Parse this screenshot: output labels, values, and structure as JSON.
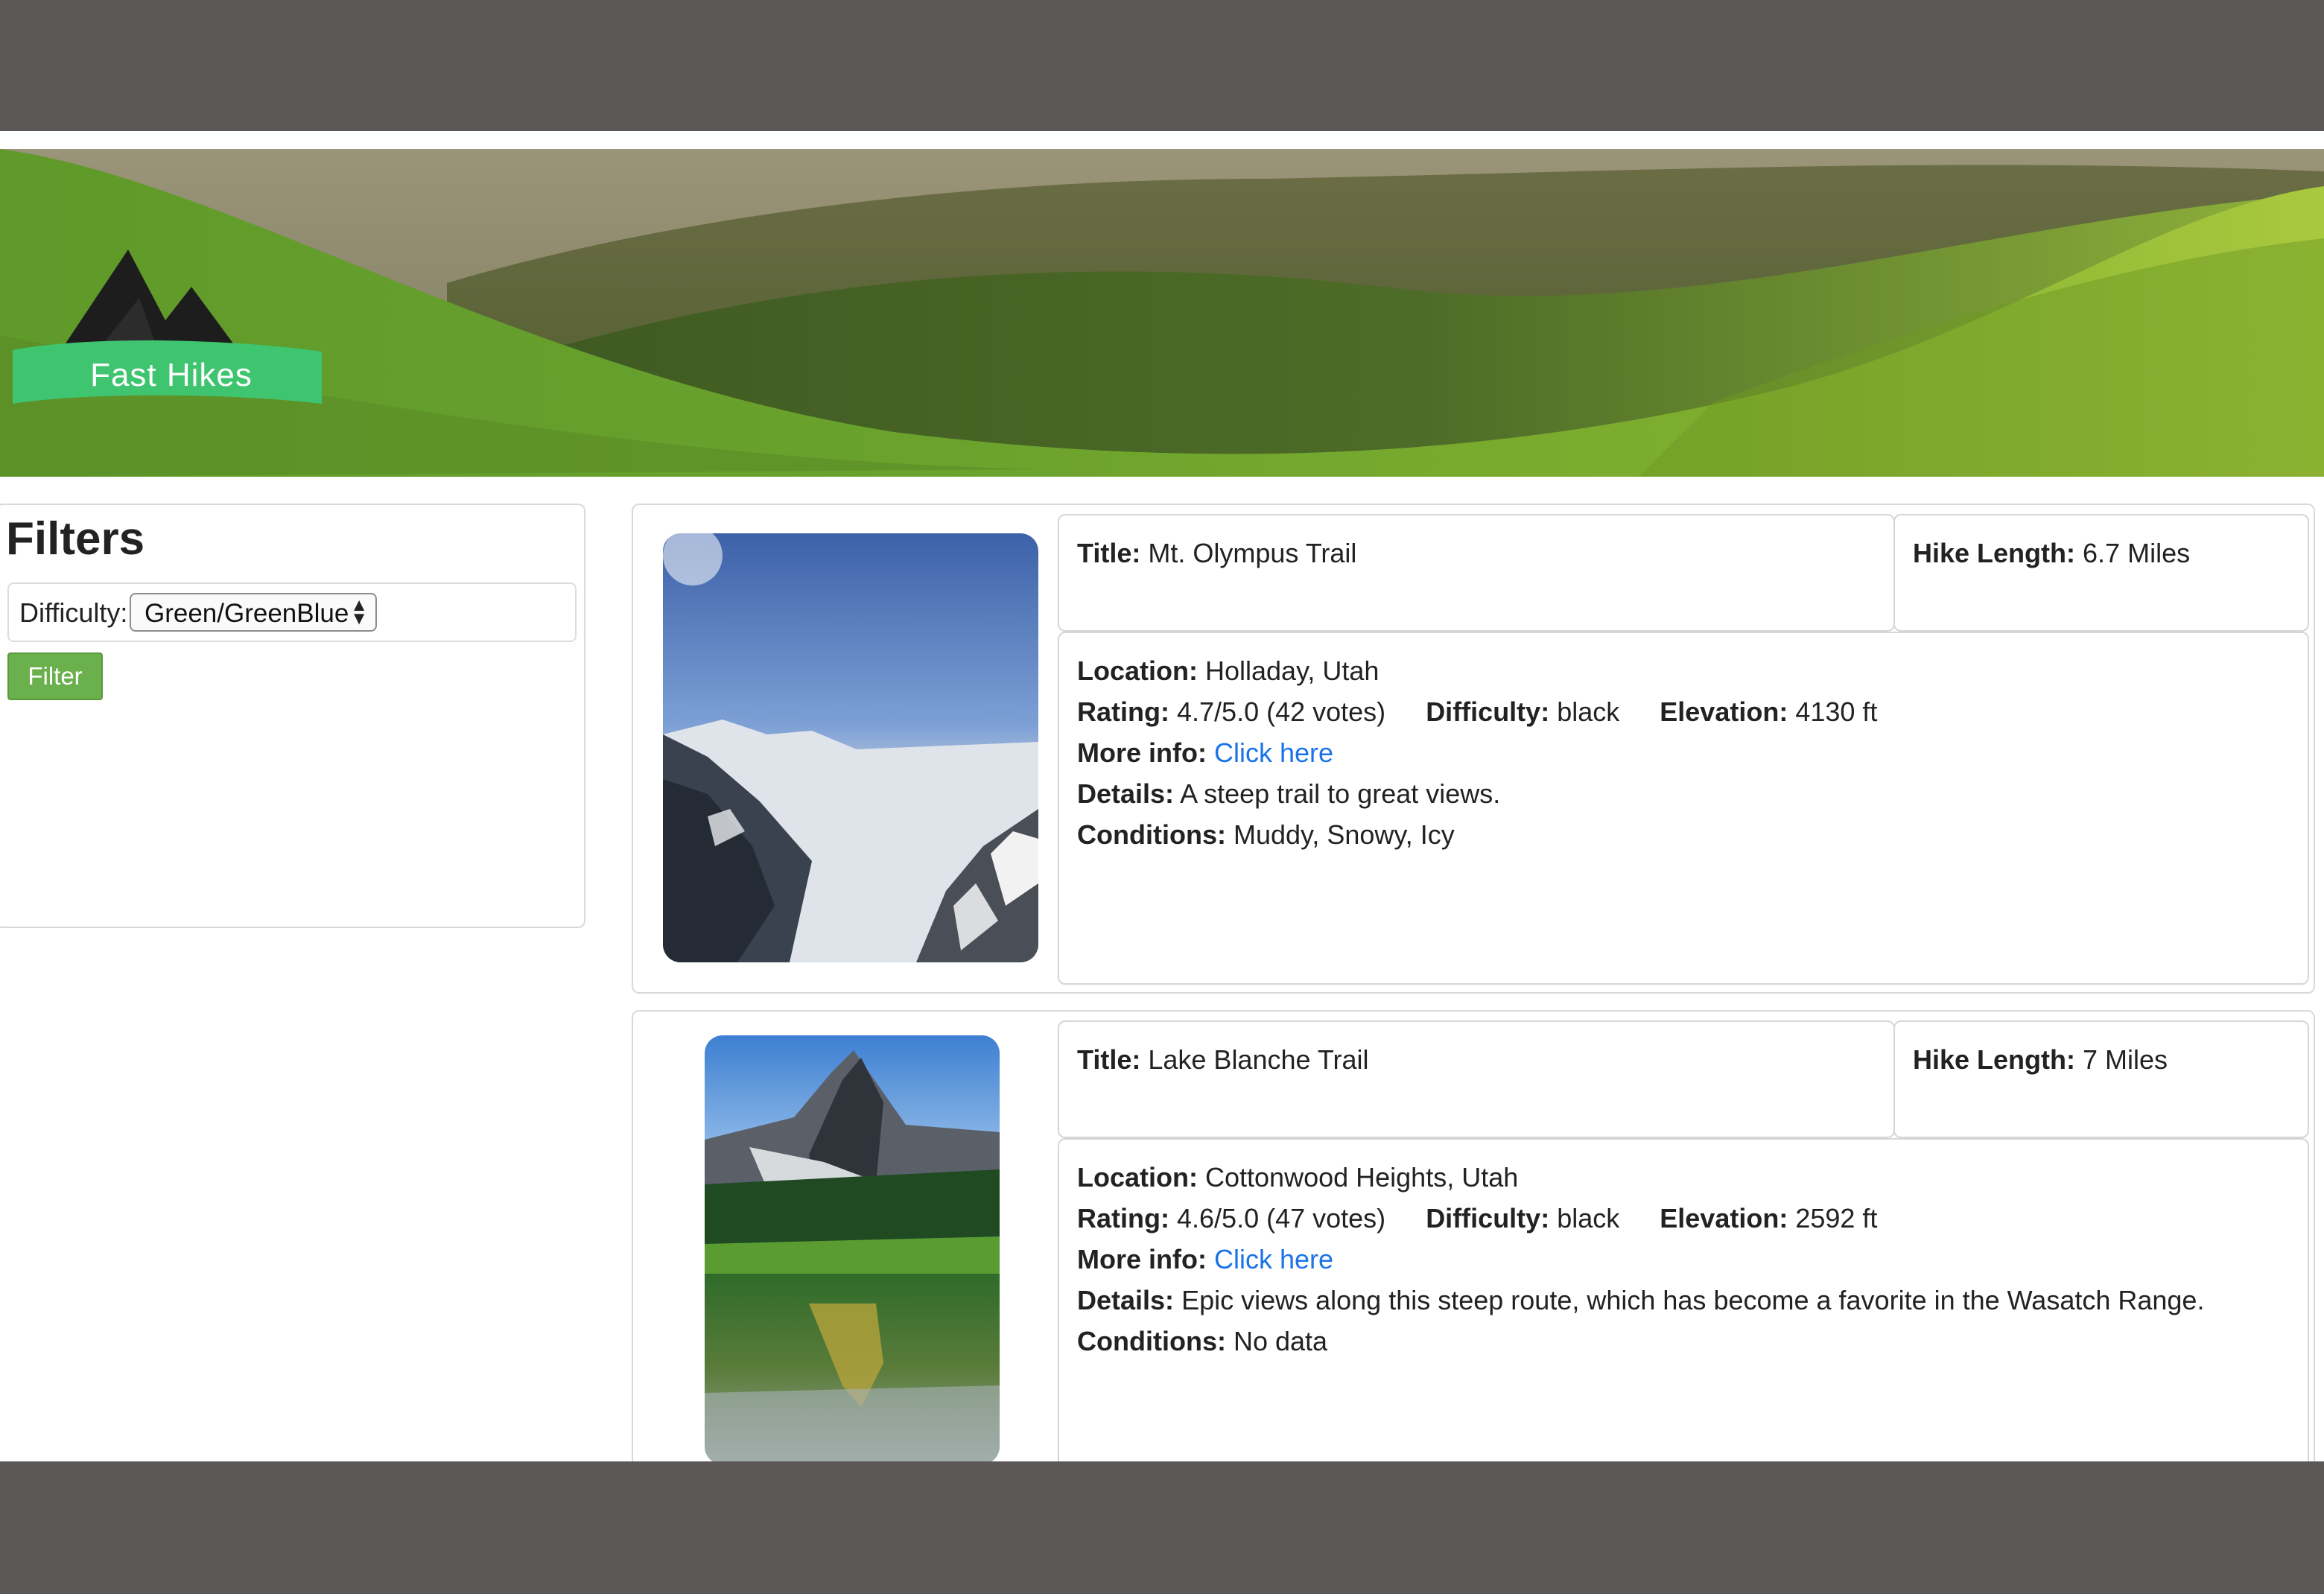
{
  "header": {
    "logo_text": "Fast Hikes",
    "brand_color": "#3fc46f"
  },
  "filters": {
    "title": "Filters",
    "difficulty_label": "Difficulty:",
    "difficulty_selected": "Green/GreenBlue",
    "filter_button": "Filter"
  },
  "hikes": [
    {
      "title_label": "Title:",
      "title": "Mt. Olympus Trail",
      "length_label": "Hike Length:",
      "length": "6.7 Miles",
      "location_label": "Location:",
      "location": "Holladay, Utah",
      "rating_label": "Rating:",
      "rating": "4.7/5.0 (42 votes)",
      "difficulty_label": "Difficulty:",
      "difficulty": "black",
      "elevation_label": "Elevation:",
      "elevation": "4130 ft",
      "more_info_label": "More info:",
      "more_info_link": "Click here",
      "details_label": "Details:",
      "details": "A steep trail to great views.",
      "conditions_label": "Conditions:",
      "conditions": "Muddy, Snowy, Icy"
    },
    {
      "title_label": "Title:",
      "title": "Lake Blanche Trail",
      "length_label": "Hike Length:",
      "length": "7 Miles",
      "location_label": "Location:",
      "location": "Cottonwood Heights, Utah",
      "rating_label": "Rating:",
      "rating": "4.6/5.0 (47 votes)",
      "difficulty_label": "Difficulty:",
      "difficulty": "black",
      "elevation_label": "Elevation:",
      "elevation": "2592 ft",
      "more_info_label": "More info:",
      "more_info_link": "Click here",
      "details_label": "Details:",
      "details": "Epic views along this steep route, which has become a favorite in the Wasatch Range.",
      "conditions_label": "Conditions:",
      "conditions": "No data"
    }
  ]
}
